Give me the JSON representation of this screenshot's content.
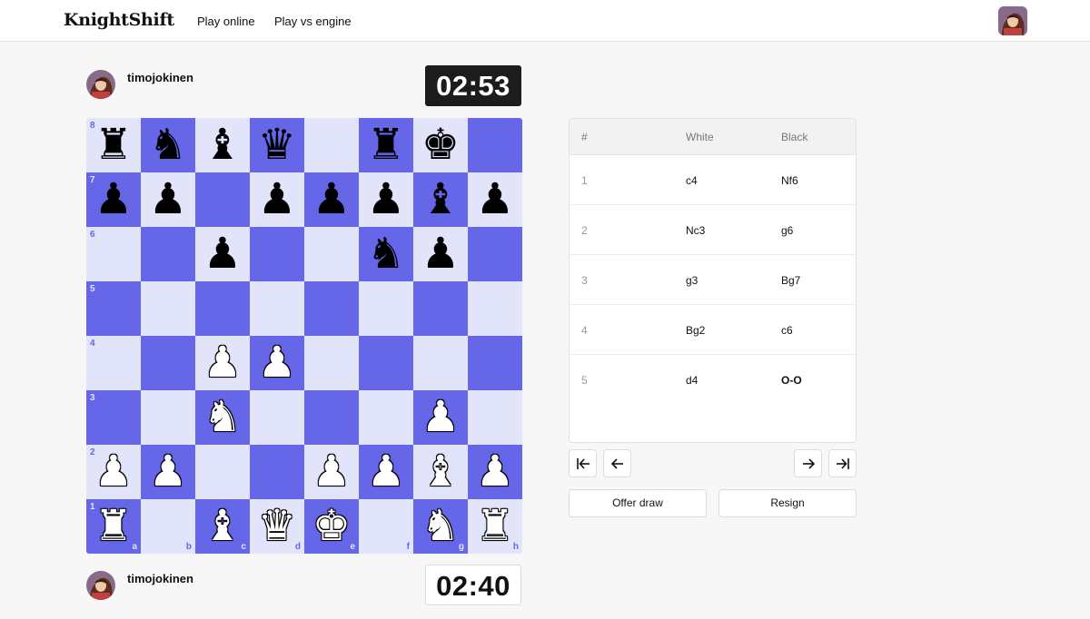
{
  "header": {
    "logo": "KnightShift",
    "nav": [
      {
        "label": "Play online"
      },
      {
        "label": "Play vs engine"
      }
    ]
  },
  "top_player": {
    "username": "timojokinen",
    "clock": "02:53"
  },
  "bottom_player": {
    "username": "timojokinen",
    "clock": "02:40"
  },
  "board": {
    "light_color": "#e2e4fa",
    "dark_color": "#6566e8",
    "files": [
      "a",
      "b",
      "c",
      "d",
      "e",
      "f",
      "g",
      "h"
    ],
    "ranks": [
      "8",
      "7",
      "6",
      "5",
      "4",
      "3",
      "2",
      "1"
    ],
    "rows": [
      [
        "bR",
        "bN",
        "bB",
        "bQ",
        "",
        "bR",
        "bK",
        ""
      ],
      [
        "bP",
        "bP",
        "",
        "bP",
        "bP",
        "bP",
        "bB",
        "bP"
      ],
      [
        "",
        "",
        "bP",
        "",
        "",
        "bN",
        "bP",
        ""
      ],
      [
        "",
        "",
        "",
        "",
        "",
        "",
        "",
        ""
      ],
      [
        "",
        "",
        "wP",
        "wP",
        "",
        "",
        "",
        ""
      ],
      [
        "",
        "",
        "wN",
        "",
        "",
        "",
        "wP",
        ""
      ],
      [
        "wP",
        "wP",
        "",
        "",
        "wP",
        "wP",
        "wB",
        "wP"
      ],
      [
        "wR",
        "",
        "wB",
        "wQ",
        "wK",
        "",
        "wN",
        "wR"
      ]
    ]
  },
  "moves": {
    "headers": {
      "num": "#",
      "white": "White",
      "black": "Black"
    },
    "rows": [
      {
        "num": "1",
        "white": "c4",
        "black": "Nf6"
      },
      {
        "num": "2",
        "white": "Nc3",
        "black": "g6"
      },
      {
        "num": "3",
        "white": "g3",
        "black": "Bg7"
      },
      {
        "num": "4",
        "white": "Bg2",
        "black": "c6"
      },
      {
        "num": "5",
        "white": "d4",
        "black": "O-O"
      }
    ]
  },
  "navigation_icons": [
    "first-move-icon",
    "previous-move-icon",
    "next-move-icon",
    "last-move-icon"
  ],
  "actions": {
    "offer_draw": "Offer draw",
    "resign": "Resign"
  }
}
